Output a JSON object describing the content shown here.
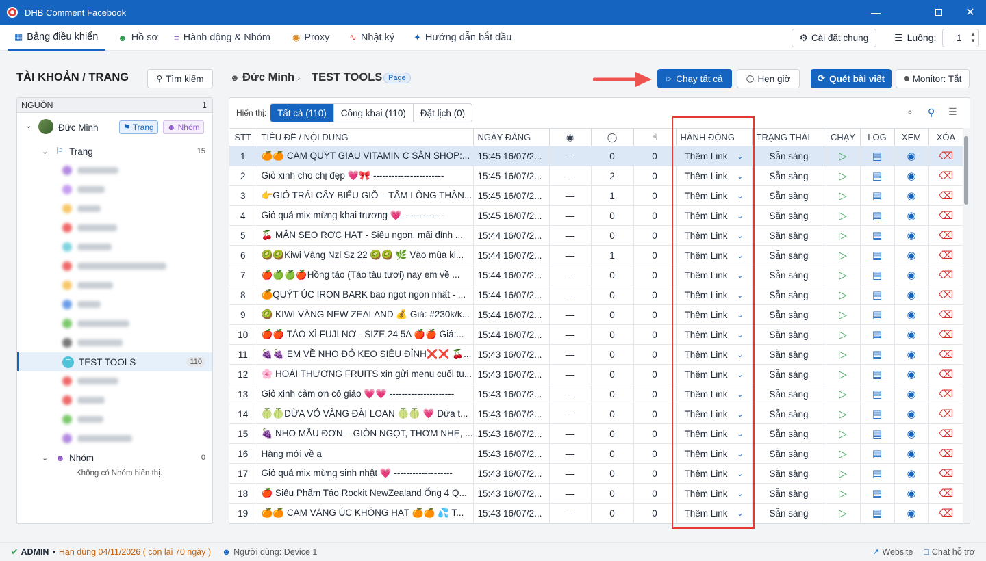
{
  "window": {
    "title": "DHB Comment Facebook"
  },
  "tabs": [
    {
      "label": "Bảng điều khiển",
      "icon": "grid-icon",
      "active": true
    },
    {
      "label": "Hồ sơ",
      "icon": "users-icon"
    },
    {
      "label": "Hành động & Nhóm",
      "icon": "list-check-icon"
    },
    {
      "label": "Proxy",
      "icon": "globe-icon"
    },
    {
      "label": "Nhật ký",
      "icon": "activity-icon"
    },
    {
      "label": "Hướng dẫn bắt đầu",
      "icon": "sparkle-icon"
    }
  ],
  "menubar_right": {
    "settings_label": "Cài đặt chung",
    "threads_label": "Luồng:",
    "threads_value": "1"
  },
  "left": {
    "heading": "TÀI KHOẢN / TRANG",
    "search_label": "Tìm kiếm",
    "source_label": "NGUỒN",
    "source_count": "1",
    "account_name": "Đức Minh",
    "pill_page": "Trang",
    "pill_group": "Nhóm",
    "pages_label": "Trang",
    "pages_count": "15",
    "selected_page": "TEST TOOLS",
    "selected_avatar": "T",
    "selected_count": "110",
    "groups_label": "Nhóm",
    "groups_count": "0",
    "no_groups_text": "Không có Nhóm hiển thị."
  },
  "header": {
    "account": "Đức Minh",
    "page": "TEST TOOLS",
    "badge": "Page",
    "run_all": "Chạy tất cả",
    "schedule": "Hẹn giờ",
    "scan": "Quét bài viết",
    "monitor": "Monitor: Tắt"
  },
  "filter": {
    "label": "Hiển thị:",
    "all": "Tất cả (110)",
    "public": "Công khai (110)",
    "scheduled": "Đặt lịch (0)"
  },
  "table": {
    "headers": {
      "stt": "STT",
      "title": "TIÊU ĐỀ / NỘI DUNG",
      "date": "NGÀY ĐĂNG",
      "action": "HÀNH ĐỘNG",
      "status": "TRẠNG THÁI",
      "run": "CHẠY",
      "log": "LOG",
      "view": "XEM",
      "delete": "XÓA"
    },
    "rows": [
      {
        "stt": "1",
        "title": "🍊🍊 CAM QUÝT GIÀU VITAMIN C SẴN SHOP:...",
        "date": "15:45 16/07/2...",
        "views": "—",
        "comments": "0",
        "likes": "0",
        "action": "Thêm Link",
        "status": "Sẵn sàng"
      },
      {
        "stt": "2",
        "title": "Giỏ xinh cho chị đẹp 💗🎀 -----------------------",
        "date": "15:45 16/07/2...",
        "views": "—",
        "comments": "2",
        "likes": "0",
        "action": "Thêm Link",
        "status": "Sẵn sàng"
      },
      {
        "stt": "3",
        "title": "👉GIỎ TRÁI CÂY BIẾU GIỖ – TẤM LÒNG THÀN...",
        "date": "15:45 16/07/2...",
        "views": "—",
        "comments": "1",
        "likes": "0",
        "action": "Thêm Link",
        "status": "Sẵn sàng"
      },
      {
        "stt": "4",
        "title": "Giỏ quả mix mừng khai trương 💗 -------------",
        "date": "15:45 16/07/2...",
        "views": "—",
        "comments": "0",
        "likes": "0",
        "action": "Thêm Link",
        "status": "Sẵn sàng"
      },
      {
        "stt": "5",
        "title": "🍒 MẬN SEO RƠC HẠT - Siêu ngon, mãi đỉnh ...",
        "date": "15:44 16/07/2...",
        "views": "—",
        "comments": "0",
        "likes": "0",
        "action": "Thêm Link",
        "status": "Sẵn sàng"
      },
      {
        "stt": "6",
        "title": "🥝🥝Kiwi Vàng Nzl Sz 22 🥝🥝 🌿 Vào mùa ki...",
        "date": "15:44 16/07/2...",
        "views": "—",
        "comments": "1",
        "likes": "0",
        "action": "Thêm Link",
        "status": "Sẵn sàng"
      },
      {
        "stt": "7",
        "title": "🍎🍏🍏🍎Hồng táo (Táo tàu tươi) nay em về ...",
        "date": "15:44 16/07/2...",
        "views": "—",
        "comments": "0",
        "likes": "0",
        "action": "Thêm Link",
        "status": "Sẵn sàng"
      },
      {
        "stt": "8",
        "title": "🍊QUÝT ÚC IRON BARK bao ngọt ngon nhất - ...",
        "date": "15:44 16/07/2...",
        "views": "—",
        "comments": "0",
        "likes": "0",
        "action": "Thêm Link",
        "status": "Sẵn sàng"
      },
      {
        "stt": "9",
        "title": "🥝 KIWI VÀNG NEW ZEALAND 💰 Giá: #230k/k...",
        "date": "15:44 16/07/2...",
        "views": "—",
        "comments": "0",
        "likes": "0",
        "action": "Thêm Link",
        "status": "Sẵn sàng"
      },
      {
        "stt": "10",
        "title": "🍎🍎 TÁO XÌ FUJI NƠ - SIZE 24 5A 🍎🍎 Giá:...",
        "date": "15:44 16/07/2...",
        "views": "—",
        "comments": "0",
        "likes": "0",
        "action": "Thêm Link",
        "status": "Sẵn sàng"
      },
      {
        "stt": "11",
        "title": "🍇🍇 EM VỀ NHO ĐỎ KẸO SIÊU ĐỈNH❌❌ 🍒...",
        "date": "15:43 16/07/2...",
        "views": "—",
        "comments": "0",
        "likes": "0",
        "action": "Thêm Link",
        "status": "Sẵn sàng"
      },
      {
        "stt": "12",
        "title": "🌸 HOÀI THƯƠNG FRUITS xin gửi menu cuối tu...",
        "date": "15:43 16/07/2...",
        "views": "—",
        "comments": "0",
        "likes": "0",
        "action": "Thêm Link",
        "status": "Sẵn sàng"
      },
      {
        "stt": "13",
        "title": "Giỏ xinh cảm ơn cô giáo 💗💗 ---------------------",
        "date": "15:43 16/07/2...",
        "views": "—",
        "comments": "0",
        "likes": "0",
        "action": "Thêm Link",
        "status": "Sẵn sàng"
      },
      {
        "stt": "14",
        "title": "🍈🍈DỪA VỎ VÀNG ĐÀI LOAN 🍈🍈 💗 Dừa t...",
        "date": "15:43 16/07/2...",
        "views": "—",
        "comments": "0",
        "likes": "0",
        "action": "Thêm Link",
        "status": "Sẵn sàng"
      },
      {
        "stt": "15",
        "title": "🍇 NHO MẪU ĐƠN – GIÒN NGỌT, THƠM NHẸ, ...",
        "date": "15:43 16/07/2...",
        "views": "—",
        "comments": "0",
        "likes": "0",
        "action": "Thêm Link",
        "status": "Sẵn sàng"
      },
      {
        "stt": "16",
        "title": "Hàng mới về ạ",
        "date": "15:43 16/07/2...",
        "views": "—",
        "comments": "0",
        "likes": "0",
        "action": "Thêm Link",
        "status": "Sẵn sàng"
      },
      {
        "stt": "17",
        "title": "Giỏ quả mix mừng sinh nhật 💗 -------------------",
        "date": "15:43 16/07/2...",
        "views": "—",
        "comments": "0",
        "likes": "0",
        "action": "Thêm Link",
        "status": "Sẵn sàng"
      },
      {
        "stt": "18",
        "title": "🍎 Siêu Phẩm Táo Rockit NewZealand Ống 4 Q...",
        "date": "15:43 16/07/2...",
        "views": "—",
        "comments": "0",
        "likes": "0",
        "action": "Thêm Link",
        "status": "Sẵn sàng"
      },
      {
        "stt": "19",
        "title": "🍊🍊 CAM VÀNG ÚC KHÔNG HẠT 🍊🍊 💦 T...",
        "date": "15:43 16/07/2...",
        "views": "—",
        "comments": "0",
        "likes": "0",
        "action": "Thêm Link",
        "status": "Sẵn sàng"
      }
    ]
  },
  "status": {
    "role": "ADMIN",
    "expiry": "Hạn dùng 04/11/2026 ( còn lại 70 ngày )",
    "user": "Người dùng: Device 1",
    "website": "Website",
    "support": "Chat hỗ trợ"
  },
  "colors": {
    "primary": "#1565c0",
    "highlight": "#e53935",
    "success": "#2e9e4f",
    "danger": "#d32f2f"
  }
}
